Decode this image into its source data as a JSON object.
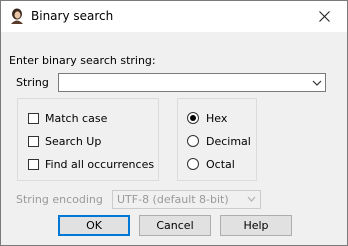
{
  "window": {
    "title": "Binary search"
  },
  "prompt": "Enter binary search string:",
  "string_field": {
    "label": "String",
    "value": ""
  },
  "options": {
    "match_case": {
      "label": "Match case",
      "checked": false
    },
    "search_up": {
      "label": "Search Up",
      "checked": false
    },
    "find_all": {
      "label": "Find all occurrences",
      "checked": false
    }
  },
  "format": {
    "hex": {
      "label": "Hex",
      "selected": true
    },
    "decimal": {
      "label": "Decimal",
      "selected": false
    },
    "octal": {
      "label": "Octal",
      "selected": false
    }
  },
  "encoding": {
    "label": "String encoding",
    "value": "UTF-8 (default 8-bit)"
  },
  "buttons": {
    "ok": "OK",
    "cancel": "Cancel",
    "help": "Help"
  },
  "icons": {
    "app": "portrait-icon",
    "close": "close-icon"
  },
  "colors": {
    "default_button_border": "#0078d7",
    "disabled_text": "#9a9a9a"
  }
}
